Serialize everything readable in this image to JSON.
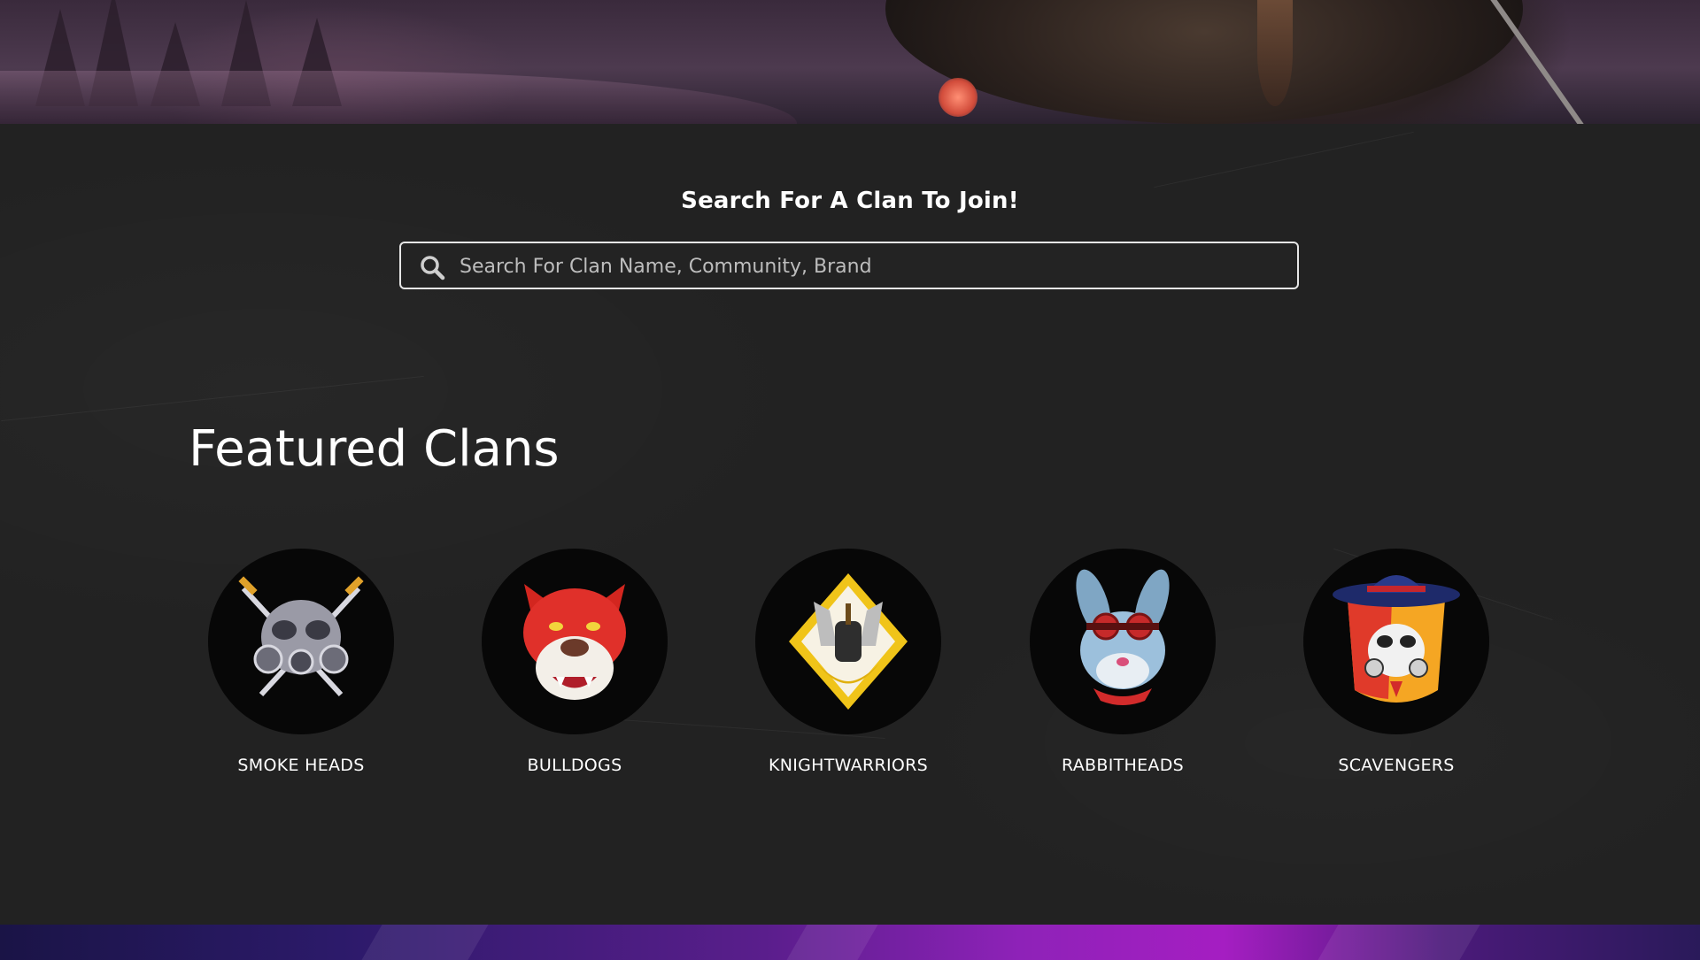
{
  "search": {
    "heading": "Search For A Clan To Join!",
    "placeholder": "Search For Clan Name, Community, Brand",
    "value": ""
  },
  "featured": {
    "title": "Featured Clans",
    "clans": [
      {
        "name": "SMOKE HEADS",
        "icon": "gas-mask-daggers-logo",
        "accent": "#c9c9d4"
      },
      {
        "name": "BULLDOGS",
        "icon": "red-bulldog-logo",
        "accent": "#e0302a"
      },
      {
        "name": "KNIGHTWARRIORS",
        "icon": "winged-knight-helmet-logo",
        "accent": "#f0c419"
      },
      {
        "name": "RABBITHEADS",
        "icon": "rabbit-goggles-logo",
        "accent": "#8fb6d6"
      },
      {
        "name": "SCAVENGERS",
        "icon": "cowboy-gas-mask-logo",
        "accent": "#f5a623"
      }
    ]
  },
  "colors": {
    "background": "#222222",
    "text": "#ffffff",
    "search_border": "#e6e6e6",
    "placeholder": "#bdbdbd"
  }
}
